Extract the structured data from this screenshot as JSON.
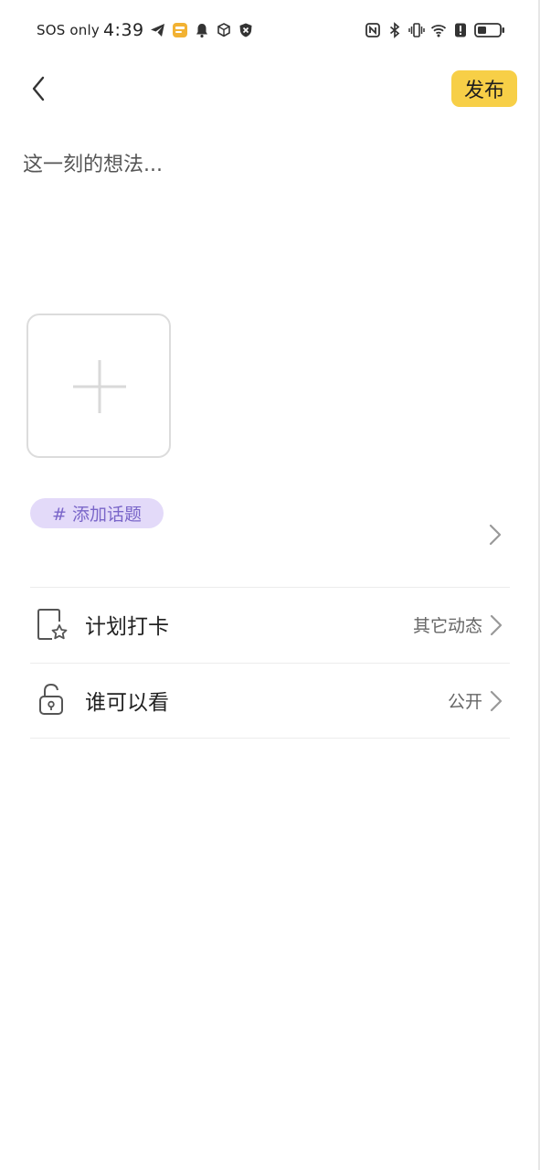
{
  "status_bar": {
    "carrier": "SOS only",
    "time": "4:39"
  },
  "header": {
    "publish_label": "发布"
  },
  "composer": {
    "placeholder": "这一刻的想法..."
  },
  "topic": {
    "label": "# 添加话题"
  },
  "rows": [
    {
      "label": "计划打卡",
      "value": "其它动态"
    },
    {
      "label": "谁可以看",
      "value": "公开"
    }
  ],
  "colors": {
    "publish_bg": "#f7cf47",
    "topic_bg": "#e3daf9",
    "topic_text": "#7a66c9"
  }
}
